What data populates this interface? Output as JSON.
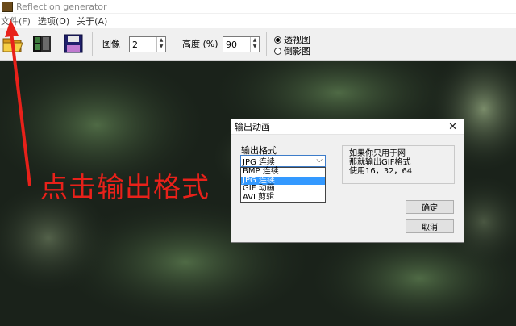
{
  "window": {
    "title": "Reflection generator"
  },
  "menu": [
    "文件(F)",
    "选项(O)",
    "关于(A)"
  ],
  "toolbar": {
    "image_label": "图像",
    "image_value": "2",
    "height_label": "高度 (%)",
    "height_value": "90",
    "radio_perspective": "透视图",
    "radio_inverted": "倒影图"
  },
  "annotation": {
    "text": "点击输出格式"
  },
  "dialog": {
    "title": "输出动画",
    "close_glyph": "✕",
    "format_label": "输出格式",
    "selected": "JPG 连续",
    "options": [
      "BMP 连续",
      "JPG 连续",
      "GIF 动画",
      "AVI 剪辑"
    ],
    "info_lines": [
      "如果你只用于网",
      "那就输出GIF格式",
      "使用16，32，64"
    ],
    "ok": "确定",
    "cancel": "取消"
  },
  "colors": {
    "annotation_red": "#e8211a",
    "selection_blue": "#3399ff"
  }
}
